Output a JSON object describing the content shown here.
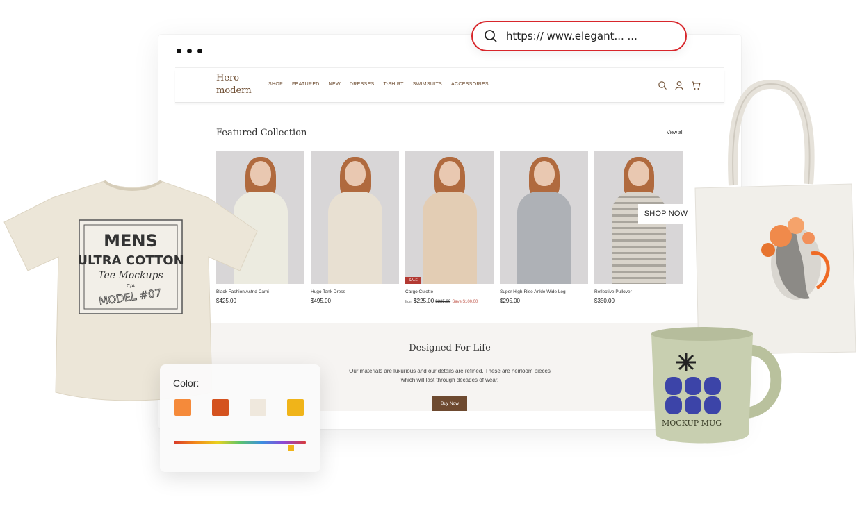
{
  "url_bar": {
    "text": "https:// www.elegant... ..."
  },
  "store": {
    "logo": "Hero-\nmodern",
    "logo_line1": "Hero-",
    "logo_line2": "modern",
    "menu": [
      "SHOP",
      "FEATURED",
      "NEW",
      "DRESSES",
      "T-SHIRT",
      "SWIMSUITS",
      "ACCESSORIES"
    ],
    "icons": [
      "search-icon",
      "user-icon",
      "cart-icon"
    ]
  },
  "featured": {
    "title": "Featured Collection",
    "view_all": "View all",
    "products": [
      {
        "name": "Black Fashion Astrid Cami",
        "price": "$425.00",
        "outfit": "#ecebe0"
      },
      {
        "name": "Hugo Tank Dress",
        "price": "$495.00",
        "outfit": "#e8e0d2"
      },
      {
        "name": "Cargo Culotte",
        "from": "from",
        "price": "$225.00",
        "old_price": "$325.00",
        "save": "Save $100.00",
        "badge": "SALE",
        "outfit": "#e3cdb4"
      },
      {
        "name": "Super High-Rise Ankle Wide Leg",
        "price": "$295.00",
        "outfit": "#aeb1b6"
      },
      {
        "name": "Reflective Pullover",
        "price": "$350.00",
        "outfit": "#cfcbc2"
      }
    ],
    "shop_now": "SHOP NOW"
  },
  "designed": {
    "title": "Designed For Life",
    "text": "Our materials are luxurious and our details are refined. These are heirloom pieces which will last through decades of wear.",
    "button": "Buy Now"
  },
  "tshirt": {
    "line1": "MENS",
    "line2": "ULTRA COTTON",
    "line3": "Tee Mockups",
    "line4": "C/A",
    "line5": "MODEL #07",
    "color": "#ece6d8"
  },
  "color_card": {
    "label": "Color:",
    "swatches": [
      "#f58a3a",
      "#d4521f",
      "#efe8dd",
      "#f0b419"
    ],
    "slider_value": 0.9
  },
  "mug": {
    "text": "MOCKUP MUG",
    "color": "#c8cfb0",
    "graphic": "#3c44a8"
  }
}
